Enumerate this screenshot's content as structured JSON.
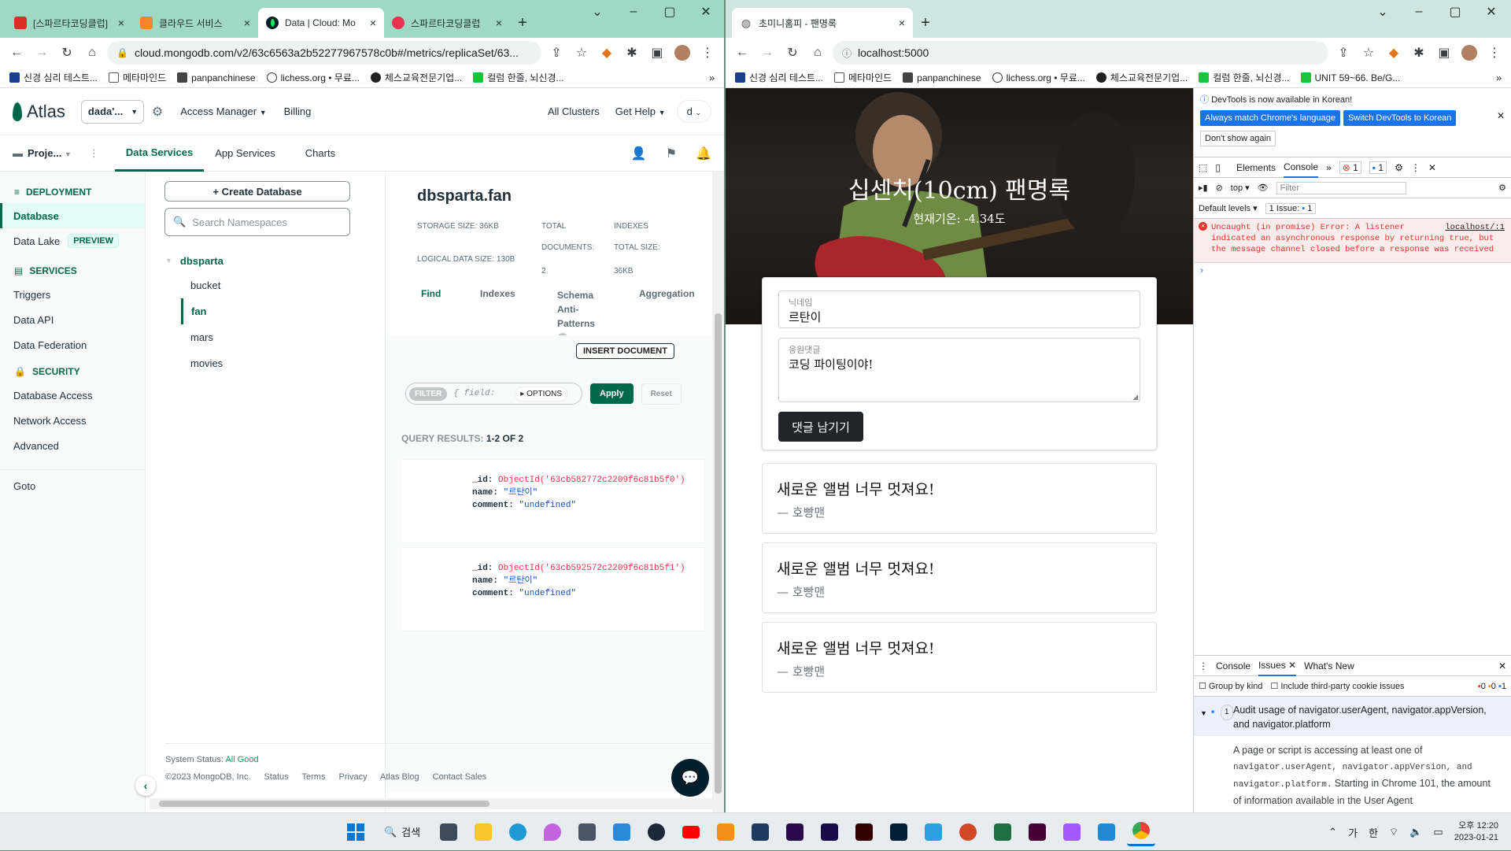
{
  "left_window": {
    "tabs": [
      {
        "title": "[스파르타코딩클럽]",
        "color": "#d93025",
        "active": false
      },
      {
        "title": "클라우드 서비스",
        "color": "#f5862a",
        "active": false
      },
      {
        "title": "Data | Cloud: Mo",
        "color": "#00684a",
        "active": true
      },
      {
        "title": "스파르타코딩클럽",
        "color": "#e8344e",
        "active": false
      }
    ],
    "url": "cloud.mongodb.com/v2/63c6563a2b52277967578c0b#/metrics/replicaSet/63...",
    "bookmarks": [
      "신경 심리 테스트...",
      "메타마인드",
      "panpanchinese",
      "lichess.org • 무료...",
      "체스교육전문기업...",
      "컬럼 한줄, 뇌신경..."
    ],
    "atlas": {
      "logo": "Atlas",
      "org": "dada'...",
      "access_manager": "Access Manager",
      "billing": "Billing",
      "all_clusters": "All Clusters",
      "get_help": "Get Help",
      "user": "d",
      "project": "Proje...",
      "subtabs": [
        "Data Services",
        "App Services",
        "Charts"
      ],
      "sidebar": {
        "deployment": "DEPLOYMENT",
        "database": "Database",
        "data_lake": "Data Lake",
        "preview": "PREVIEW",
        "services": "SERVICES",
        "triggers": "Triggers",
        "data_api": "Data API",
        "data_federation": "Data Federation",
        "security": "SECURITY",
        "database_access": "Database Access",
        "network_access": "Network Access",
        "advanced": "Advanced",
        "goto": "Goto"
      },
      "create_db": "+ Create Database",
      "search_placeholder": "Search Namespaces",
      "db_name": "dbsparta",
      "collections": [
        "bucket",
        "fan",
        "mars",
        "movies"
      ],
      "collection": {
        "title": "dbsparta.fan",
        "storage_size": "STORAGE SIZE: 36KB",
        "logical_size": "LOGICAL DATA SIZE: 130B",
        "total_documents_label1": "TOTAL",
        "total_documents_label2": "DOCUMENTS:",
        "total_documents": "2",
        "indexes_label1": "INDEXES",
        "indexes_label2": "TOTAL SIZE:",
        "indexes_size": "36KB",
        "tabs": [
          "Find",
          "Indexes",
          "Schema Anti-Patterns",
          "Aggregation"
        ],
        "schema_badge": "0",
        "insert_document": "INSERT DOCUMENT",
        "filter_label": "FILTER",
        "filter_placeholder": "{ field:",
        "options": "▸ OPTIONS",
        "apply": "Apply",
        "reset": "Reset",
        "query_results_label": "QUERY RESULTS:",
        "query_results": "1-2 OF 2",
        "documents": [
          {
            "id": "ObjectId('63cb582772c2209f6c81b5f0')",
            "name": "\"르탄이\"",
            "comment": "\"undefined\""
          },
          {
            "id": "ObjectId('63cb592572c2209f6c81b5f1')",
            "name": "\"르탄이\"",
            "comment": "\"undefined\""
          }
        ]
      },
      "footer": {
        "status_label": "System Status:",
        "status": "All Good",
        "copyright": "©2023 MongoDB, Inc.",
        "links": [
          "Status",
          "Terms",
          "Privacy",
          "Atlas Blog",
          "Contact Sales"
        ]
      }
    }
  },
  "right_window": {
    "tab_title": "초미니홈피 - 팬명록",
    "url": "localhost:5000",
    "bookmarks": [
      "신경 심리 테스트...",
      "메타마인드",
      "panpanchinese",
      "lichess.org • 무료...",
      "체스교육전문기업...",
      "컬럼 한줄, 뇌신경...",
      "UNIT 59~66. Be/G..."
    ],
    "fanpage": {
      "title": "십센치(10cm) 팬명록",
      "weather": "현재기온: -4.34도",
      "nickname_label": "닉네임",
      "nickname_value": "르탄이",
      "comment_label": "응원댓글",
      "comment_value": "코딩 파이팅이야!",
      "post_button": "댓글 남기기",
      "comments": [
        {
          "text": "새로운 앨범 너무 멋져요!",
          "author": "— 호빵맨"
        },
        {
          "text": "새로운 앨범 너무 멋져요!",
          "author": "— 호빵맨"
        },
        {
          "text": "새로운 앨범 너무 멋져요!",
          "author": "— 호빵맨"
        }
      ]
    },
    "devtools": {
      "notice": "DevTools is now available in Korean!",
      "match_lang": "Always match Chrome's language",
      "switch_korean": "Switch DevTools to Korean",
      "dont_show": "Don't show again",
      "tabs": [
        "Elements",
        "Console"
      ],
      "error_count": "1",
      "msg_count": "1",
      "context": "top",
      "filter_placeholder": "Filter",
      "levels": "Default levels",
      "issue_count": "1 Issue:",
      "issue_num": "1",
      "error_text": "Uncaught (in promise) Error: A listener indicated an asynchronous response by returning true, but the message channel closed before a response was received",
      "error_source": "localhost/:1",
      "drawer_tabs": [
        "Console",
        "Issues",
        "What's New"
      ],
      "group_by_kind": "Group by kind",
      "third_party": "Include third-party cookie issues",
      "badge_counts": [
        "0",
        "0",
        "1"
      ],
      "issue_title": "Audit usage of navigator.userAgent, navigator.appVersion, and navigator.platform",
      "issue_badge": "1",
      "issue_body_1": "A page or script is accessing at least one of",
      "issue_body_code": "navigator.userAgent, navigator.appVersion, and navigator.platform.",
      "issue_body_2": "Starting in Chrome 101, the amount of information available in the User Agent"
    }
  },
  "taskbar": {
    "search": "검색",
    "ime_1": "가",
    "ime_2": "한",
    "time": "오후 12:20",
    "date": "2023-01-21"
  }
}
